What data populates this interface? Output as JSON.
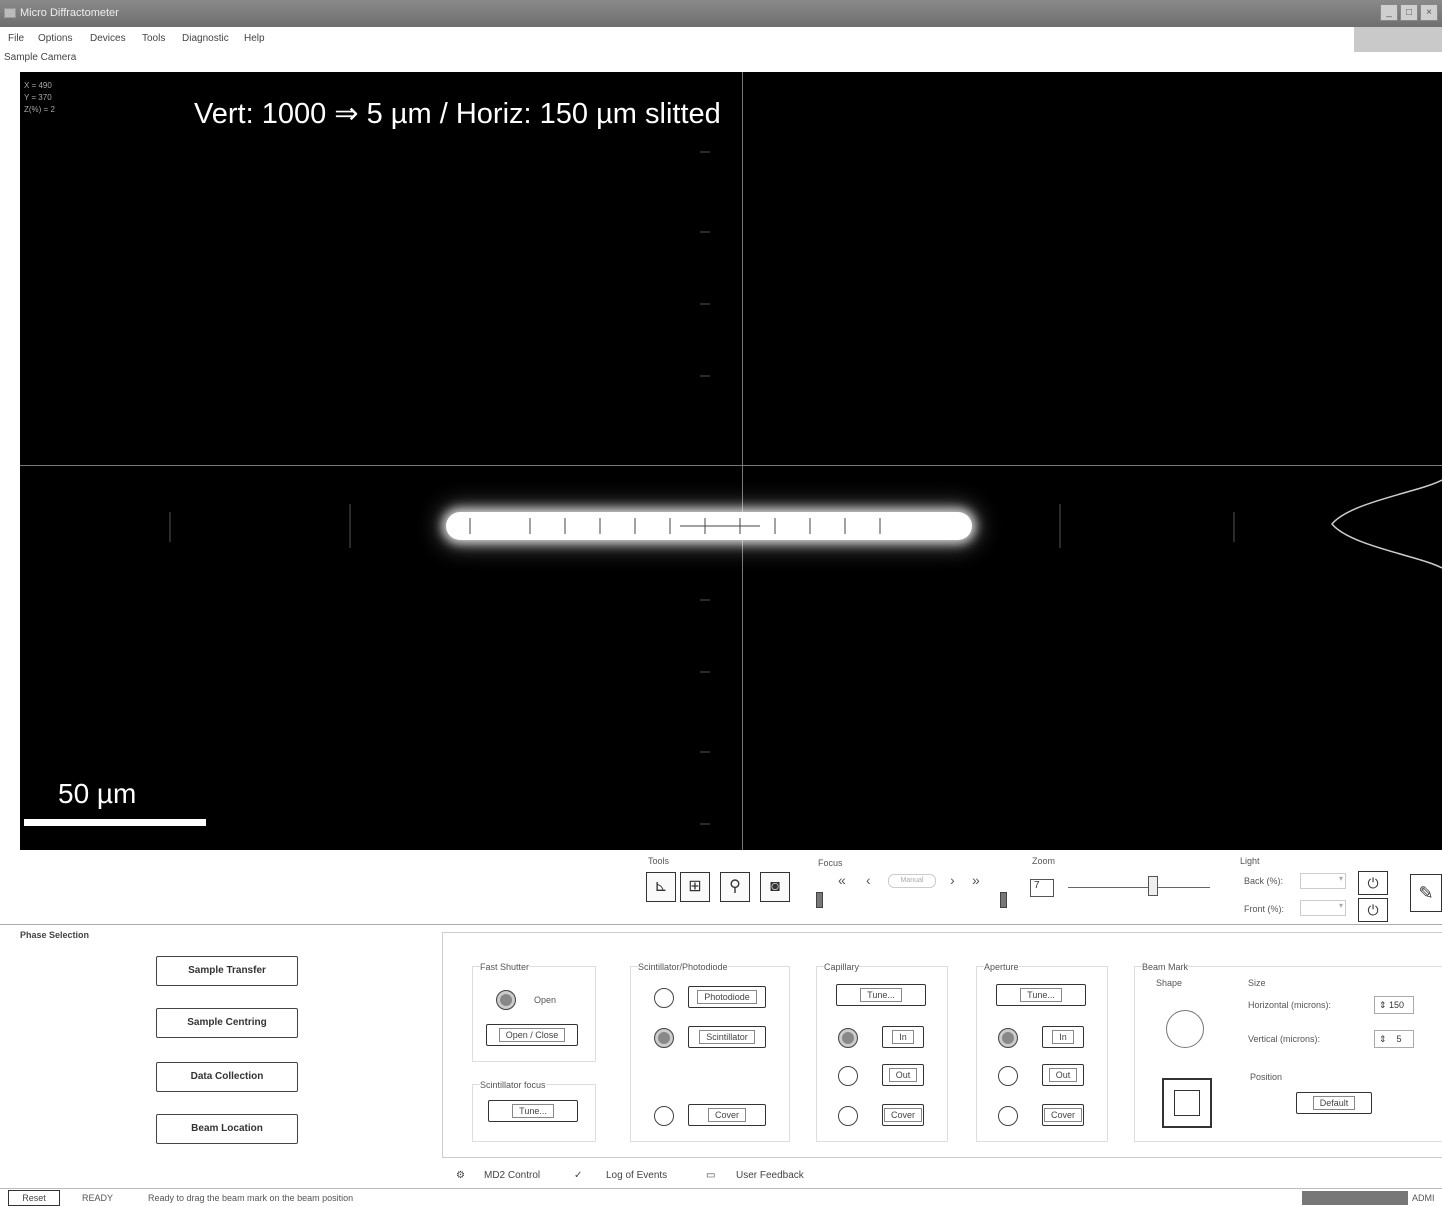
{
  "window": {
    "title": "Micro Diffractometer"
  },
  "menu": {
    "items": [
      "File",
      "Options",
      "Devices",
      "Tools",
      "Diagnostic",
      "Help"
    ]
  },
  "camera": {
    "label": "Sample Camera",
    "coords": [
      "X  =  490",
      "Y  =  370",
      "Z(%)  =  2"
    ],
    "annotation": "Vert: 1000 ⇒ 5 µm  /  Horiz: 150 µm slitted",
    "scale_label": "50 µm"
  },
  "toolbar": {
    "tools_label": "Tools",
    "focus_label": "Focus",
    "focus_placeholder": "Manual",
    "focus_fast_left": "«",
    "focus_left": "‹",
    "focus_right": "›",
    "focus_fast_right": "»",
    "zoom_label": "Zoom",
    "zoom_value": "7",
    "zoom_level": 0.6,
    "light_label": "Light",
    "back_label": "Back (%):",
    "front_label": "Front (%):"
  },
  "phase": {
    "title": "Phase Selection",
    "buttons": [
      "Sample Transfer",
      "Sample Centring",
      "Data Collection",
      "Beam Location"
    ]
  },
  "controls": {
    "fast_shutter": {
      "title": "Fast Shutter",
      "status": "Open",
      "button": "Open / Close"
    },
    "scint_focus": {
      "title": "Scintillator focus",
      "button": "Tune..."
    },
    "scint_photo": {
      "title": "Scintillator/Photodiode",
      "photodiode": "Photodiode",
      "scintillator": "Scintillator",
      "cover": "Cover"
    },
    "capillary": {
      "title": "Capillary",
      "tune": "Tune...",
      "in": "In",
      "out": "Out",
      "cover": "Cover"
    },
    "aperture": {
      "title": "Aperture",
      "tune": "Tune...",
      "in": "In",
      "out": "Out",
      "cover": "Cover"
    },
    "beam_mark": {
      "title": "Beam Mark",
      "shape": "Shape",
      "size": "Size",
      "horizontal": "Horizontal (microns):",
      "horizontal_value": "150",
      "vertical": "Vertical (microns):",
      "vertical_value": "5",
      "position": "Position",
      "default": "Default"
    }
  },
  "tabs": [
    "MD2 Control",
    "Log of Events",
    "User Feedback"
  ],
  "status": {
    "reset": "Reset",
    "state": "READY",
    "message": "Ready to drag the beam mark on the beam position",
    "user": "ADMI"
  },
  "colors": {
    "camera_bg": "#000000",
    "beam": "#ffffff"
  }
}
